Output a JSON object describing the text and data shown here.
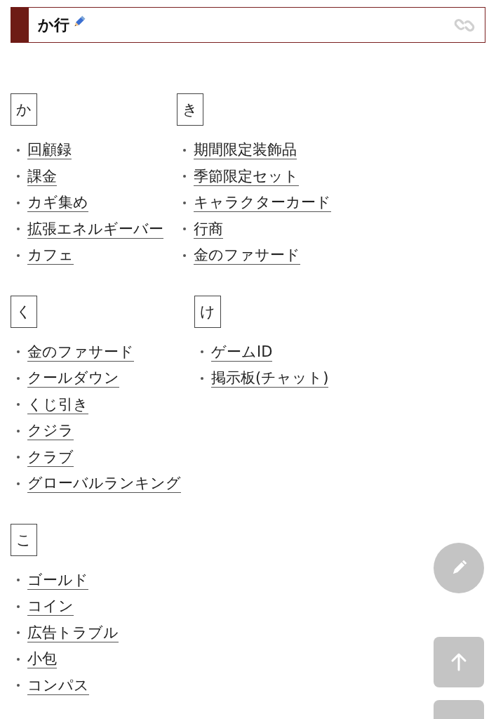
{
  "header": {
    "title": "か行"
  },
  "rows": [
    {
      "sections": [
        {
          "heading": "か",
          "items": [
            "回顧録",
            "課金",
            "カギ集め",
            "拡張エネルギーバー",
            "カフェ"
          ]
        },
        {
          "heading": "き",
          "items": [
            "期間限定装飾品",
            "季節限定セット",
            "キャラクターカード",
            "行商",
            "金のファサード"
          ]
        }
      ]
    },
    {
      "sections": [
        {
          "heading": "く",
          "items": [
            "金のファサード",
            "クールダウン",
            "くじ引き",
            "クジラ",
            "クラブ",
            "グローバルランキング"
          ]
        },
        {
          "heading": "け",
          "items": [
            "ゲームID",
            "掲示板(チャット)"
          ]
        }
      ]
    },
    {
      "sections": [
        {
          "heading": "こ",
          "items": [
            "ゴールド",
            "コイン",
            "広告トラブル",
            "小包",
            "コンパス"
          ]
        }
      ]
    }
  ]
}
